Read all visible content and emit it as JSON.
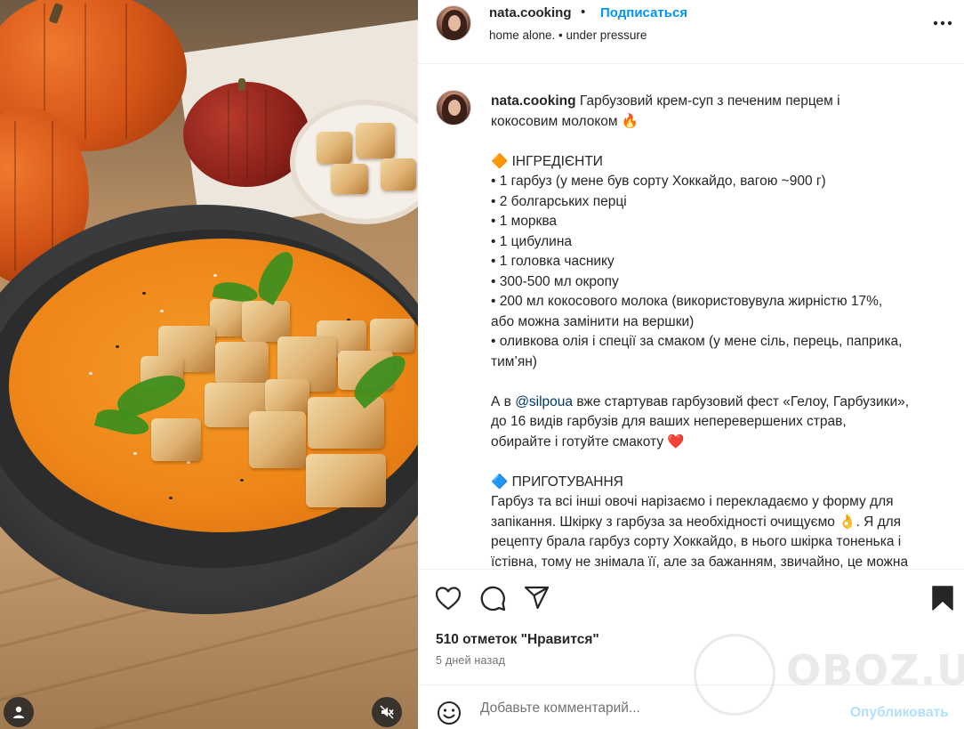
{
  "header": {
    "username": "nata.cooking",
    "dot": "•",
    "follow_label": "Подписаться",
    "audio": "home alone. • under pressure"
  },
  "caption": {
    "username": "nata.cooking",
    "title_line1": "Гарбузовий крем-суп з печеним перцем і",
    "title_line2": "кокосовим молоком 🔥",
    "ingredients_heading": "🔶 ІНГРЕДІЄНТИ",
    "ingredients": [
      "• 1 гарбуз (у мене був сорту Хоккайдо, вагою ~900 г)",
      "• 2 болгарських перці",
      "• 1 морква",
      "• 1 цибулина",
      "• 1 головка часнику",
      "• 300-500 мл окропу",
      "• 200 мл кокосового молока (використовувула жирністю 17%,",
      "або можна замінити на вершки)",
      "• оливкова олія і спеції за смаком (у мене сіль, перець, паприка,",
      "тим’ян)"
    ],
    "promo_line1_a": "А в ",
    "promo_mention": "@silpoua",
    "promo_line1_b": " вже стартував гарбузовий фест «Гелоу, Гарбузики»,",
    "promo_line2": "до 16 видів гарбузів для ваших неперевершених страв,",
    "promo_line3": "обирайте і готуйте смакоту ❤️",
    "method_heading": "🔷 ПРИГОТУВАННЯ",
    "method": [
      "Гарбуз та всі інші овочі нарізаємо і перекладаємо у форму для",
      "запікання. Шкірку з гарбуза за необхідності очищуємо 👌. Я для",
      "рецепту брала гарбуз сорту Хоккайдо, в нього шкірка тоненька і",
      "їстівна, тому не знімала її, але за бажанням, звичайно, це можна"
    ]
  },
  "actions": {
    "icons": [
      "heart-icon",
      "comment-icon",
      "share-icon",
      "bookmark-icon"
    ]
  },
  "likes_label": "510 отметок \"Нравится\"",
  "time_label": "5 дней назад",
  "comment": {
    "placeholder": "Добавьте комментарий...",
    "post_label": "Опубликовать"
  },
  "watermark": {
    "text": "OBOZ.UA"
  },
  "colors": {
    "accent": "#0095f6",
    "post_disabled": "#b2dffc",
    "mention": "#00376b"
  }
}
